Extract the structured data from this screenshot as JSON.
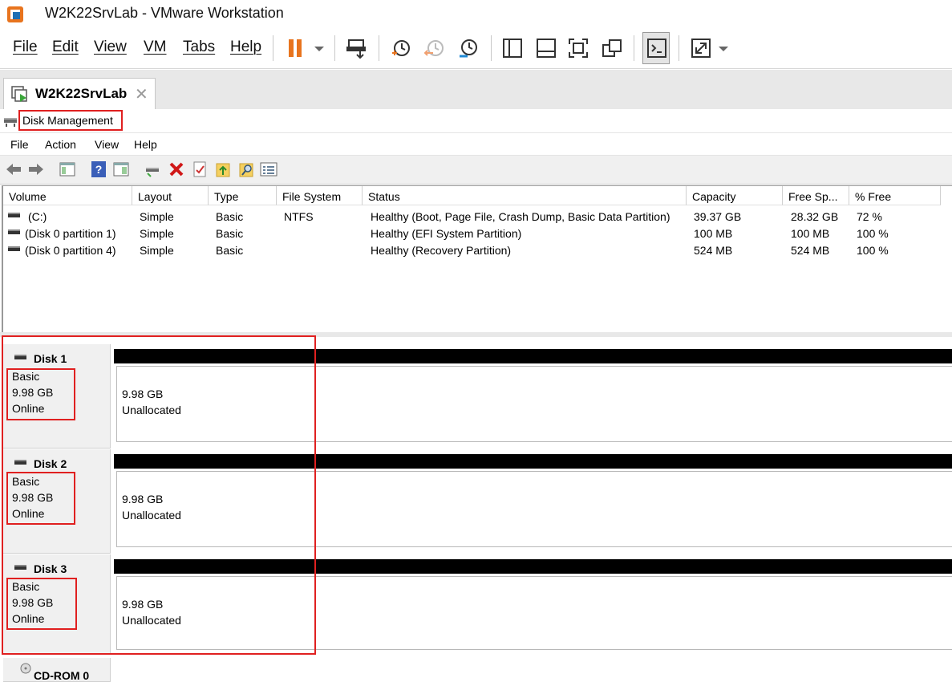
{
  "window": {
    "title": "W2K22SrvLab - VMware Workstation"
  },
  "vmware_menu": [
    "File",
    "Edit",
    "View",
    "VM",
    "Tabs",
    "Help"
  ],
  "vm_tab": {
    "label": "W2K22SrvLab"
  },
  "disk_management": {
    "title": "Disk Management",
    "menu": [
      "File",
      "Action",
      "View",
      "Help"
    ],
    "columns": [
      "Volume",
      "Layout",
      "Type",
      "File System",
      "Status",
      "Capacity",
      "Free Sp...",
      "% Free"
    ],
    "volumes": [
      {
        "volume": "(C:)",
        "layout": "Simple",
        "type": "Basic",
        "fs": "NTFS",
        "status": "Healthy (Boot, Page File, Crash Dump, Basic Data Partition)",
        "capacity": "39.37 GB",
        "free": "28.32 GB",
        "pct_free": "72 %"
      },
      {
        "volume": "(Disk 0 partition 1)",
        "layout": "Simple",
        "type": "Basic",
        "fs": "",
        "status": "Healthy (EFI System Partition)",
        "capacity": "100 MB",
        "free": "100 MB",
        "pct_free": "100 %"
      },
      {
        "volume": "(Disk 0 partition 4)",
        "layout": "Simple",
        "type": "Basic",
        "fs": "",
        "status": "Healthy (Recovery Partition)",
        "capacity": "524 MB",
        "free": "524 MB",
        "pct_free": "100 %"
      }
    ],
    "disks": [
      {
        "name": "Disk 1",
        "type": "Basic",
        "size": "9.98 GB",
        "state": "Online",
        "part_size": "9.98 GB",
        "part_status": "Unallocated"
      },
      {
        "name": "Disk 2",
        "type": "Basic",
        "size": "9.98 GB",
        "state": "Online",
        "part_size": "9.98 GB",
        "part_status": "Unallocated"
      },
      {
        "name": "Disk 3",
        "type": "Basic",
        "size": "9.98 GB",
        "state": "Online",
        "part_size": "9.98 GB",
        "part_status": "Unallocated"
      }
    ],
    "cdrom": {
      "name": "CD-ROM 0"
    }
  },
  "colors": {
    "highlight_red": "#e02020",
    "pause_orange": "#e8741e",
    "disk_bar": "#000000"
  }
}
